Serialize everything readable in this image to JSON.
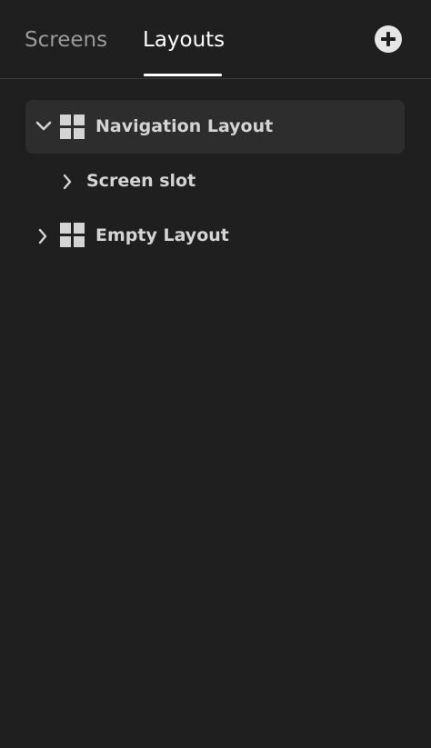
{
  "tabs": {
    "screens_label": "Screens",
    "layouts_label": "Layouts",
    "active": "Layouts"
  },
  "add_button": {
    "icon": "plus-circle-icon"
  },
  "tree": {
    "items": [
      {
        "label": "Navigation Layout",
        "expanded": true,
        "selected": true,
        "icon": "grid-icon"
      },
      {
        "label": "Screen slot",
        "expanded": false,
        "selected": false
      },
      {
        "label": "Empty Layout",
        "expanded": false,
        "selected": false,
        "icon": "grid-icon"
      }
    ]
  },
  "colors": {
    "background": "#1f1f1f",
    "selected_row": "#2d2d2d",
    "active_tab": "#ffffff",
    "inactive_tab": "#9a9a9a",
    "item_text": "#d4d4d4"
  }
}
